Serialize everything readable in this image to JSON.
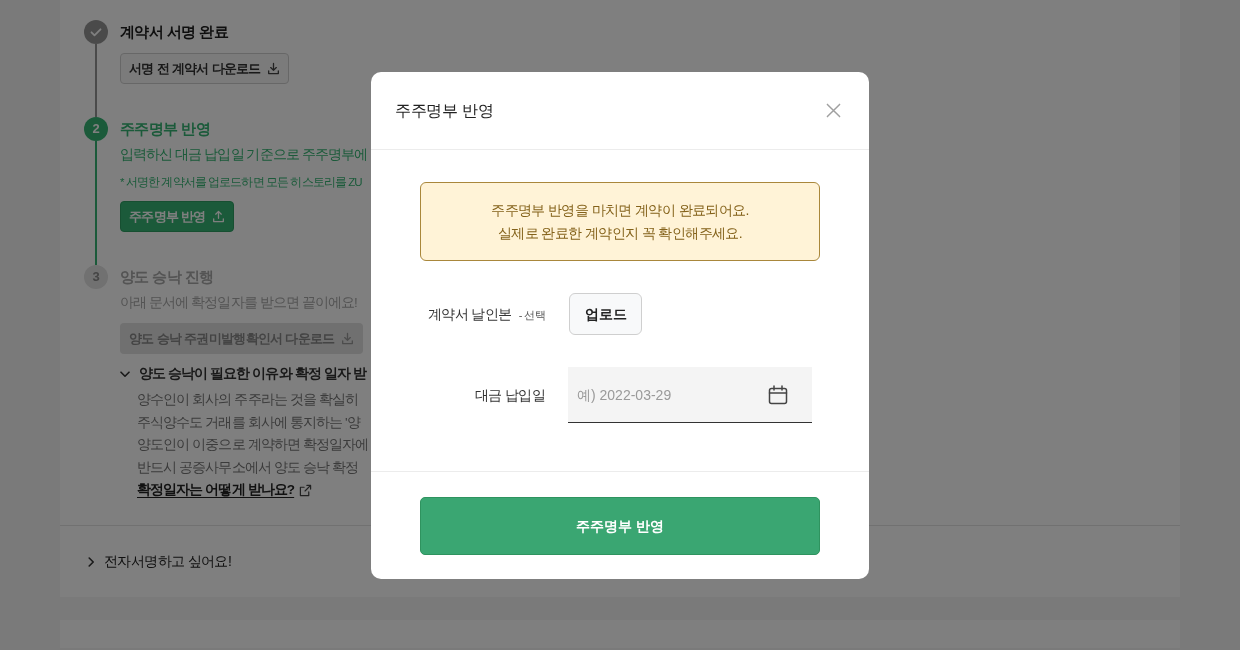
{
  "steps": [
    {
      "kind": "done",
      "title": "계약서 서명 완료",
      "button": {
        "kind": "download",
        "label": "서명 전 계약서 다운로드",
        "disabled": false
      }
    },
    {
      "kind": "active",
      "number": "2",
      "title": "주주명부 반영",
      "description": "입력하신 대금 납입일 기준으로 주주명부에",
      "note": "* 서명한 계약서를 업로드하면 모든 히스토리를 ZU",
      "button": {
        "kind": "upload",
        "label": "주주명부 반영",
        "disabled": false
      }
    },
    {
      "kind": "pending",
      "number": "3",
      "title": "양도 승낙 진행",
      "description": "아래 문서에 확정일자를 받으면 끝이에요!",
      "button": {
        "kind": "download",
        "label": "양도 승낙 주권미발행확인서 다운로드",
        "disabled": true
      },
      "details": {
        "expanded": true,
        "title": "양도 승낙이 필요한 이유와 확정 일자 받",
        "lines": [
          "양수인이 회사의 주주라는 것을 확실히",
          "주식양수도 거래를 회사에 통지하는 '양",
          "양도인이 이중으로 계약하면 확정일자에",
          "반드시 공증사무소에서 양도 승낙 확정"
        ],
        "link": "확정일자는 어떻게 받나요?"
      }
    }
  ],
  "faq": [
    {
      "title": "전자서명하고 싶어요!",
      "expanded": false
    }
  ],
  "modal": {
    "title": "주주명부 반영",
    "notice_lines": [
      "주주명부 반영을 마치면 계약이 완료되어요.",
      "실제로 완료한 계약인지 꼭 확인해주세요."
    ],
    "fields": [
      {
        "kind": "upload",
        "label": "계약서 날인본",
        "hint": "- 선택",
        "button": "업로드"
      },
      {
        "kind": "date",
        "label": "대금 납입일",
        "placeholder": "예) 2022-03-29"
      }
    ],
    "submit": "주주명부 반영"
  }
}
